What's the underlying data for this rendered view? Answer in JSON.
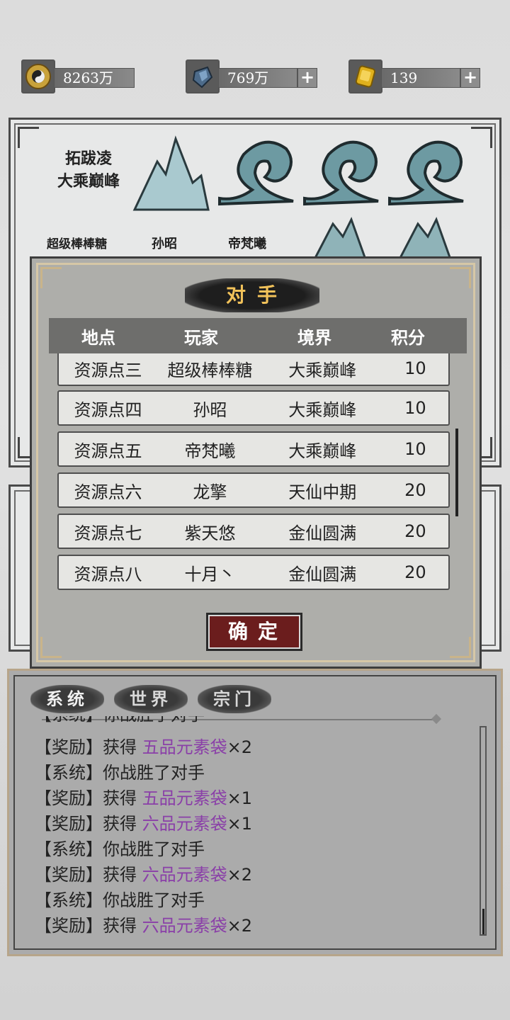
{
  "currency": [
    {
      "icon": "taiji-coin-icon",
      "value": "8263万",
      "has_plus": false
    },
    {
      "icon": "crystal-icon",
      "value": "769万",
      "has_plus": true
    },
    {
      "icon": "gold-jade-icon",
      "value": "139",
      "has_plus": true
    }
  ],
  "background_panel": {
    "team_line1": "拓跋凌",
    "team_line2": "大乘巅峰",
    "players": [
      "超级棒棒糖",
      "孙昭",
      "帝梵曦"
    ]
  },
  "modal": {
    "title": "对手",
    "headers": [
      "地点",
      "玩家",
      "境界",
      "积分"
    ],
    "rows": [
      {
        "location": "资源点三",
        "player": "超级棒棒糖",
        "realm": "大乘巅峰",
        "score": "10"
      },
      {
        "location": "资源点四",
        "player": "孙昭",
        "realm": "大乘巅峰",
        "score": "10"
      },
      {
        "location": "资源点五",
        "player": "帝梵曦",
        "realm": "大乘巅峰",
        "score": "10"
      },
      {
        "location": "资源点六",
        "player": "龙擎",
        "realm": "天仙中期",
        "score": "20"
      },
      {
        "location": "资源点七",
        "player": "紫天悠",
        "realm": "金仙圆满",
        "score": "20"
      },
      {
        "location": "资源点八",
        "player": "十月丶",
        "realm": "金仙圆满",
        "score": "20"
      }
    ],
    "confirm_label": "确定"
  },
  "chat": {
    "tabs": [
      "系统",
      "世界",
      "宗门"
    ],
    "messages": [
      {
        "tag": "【系统】",
        "text": "你战胜了对手",
        "item": "",
        "qty": ""
      },
      {
        "tag": "【奖励】",
        "text": "获得 ",
        "item": "五品元素袋",
        "qty": "×2"
      },
      {
        "tag": "【系统】",
        "text": "你战胜了对手",
        "item": "",
        "qty": ""
      },
      {
        "tag": "【奖励】",
        "text": "获得 ",
        "item": "五品元素袋",
        "qty": "×1"
      },
      {
        "tag": "【奖励】",
        "text": "获得 ",
        "item": "六品元素袋",
        "qty": "×1"
      },
      {
        "tag": "【系统】",
        "text": "你战胜了对手",
        "item": "",
        "qty": ""
      },
      {
        "tag": "【奖励】",
        "text": "获得 ",
        "item": "六品元素袋",
        "qty": "×2"
      },
      {
        "tag": "【系统】",
        "text": "你战胜了对手",
        "item": "",
        "qty": ""
      },
      {
        "tag": "【奖励】",
        "text": "获得 ",
        "item": "六品元素袋",
        "qty": "×2"
      }
    ]
  }
}
